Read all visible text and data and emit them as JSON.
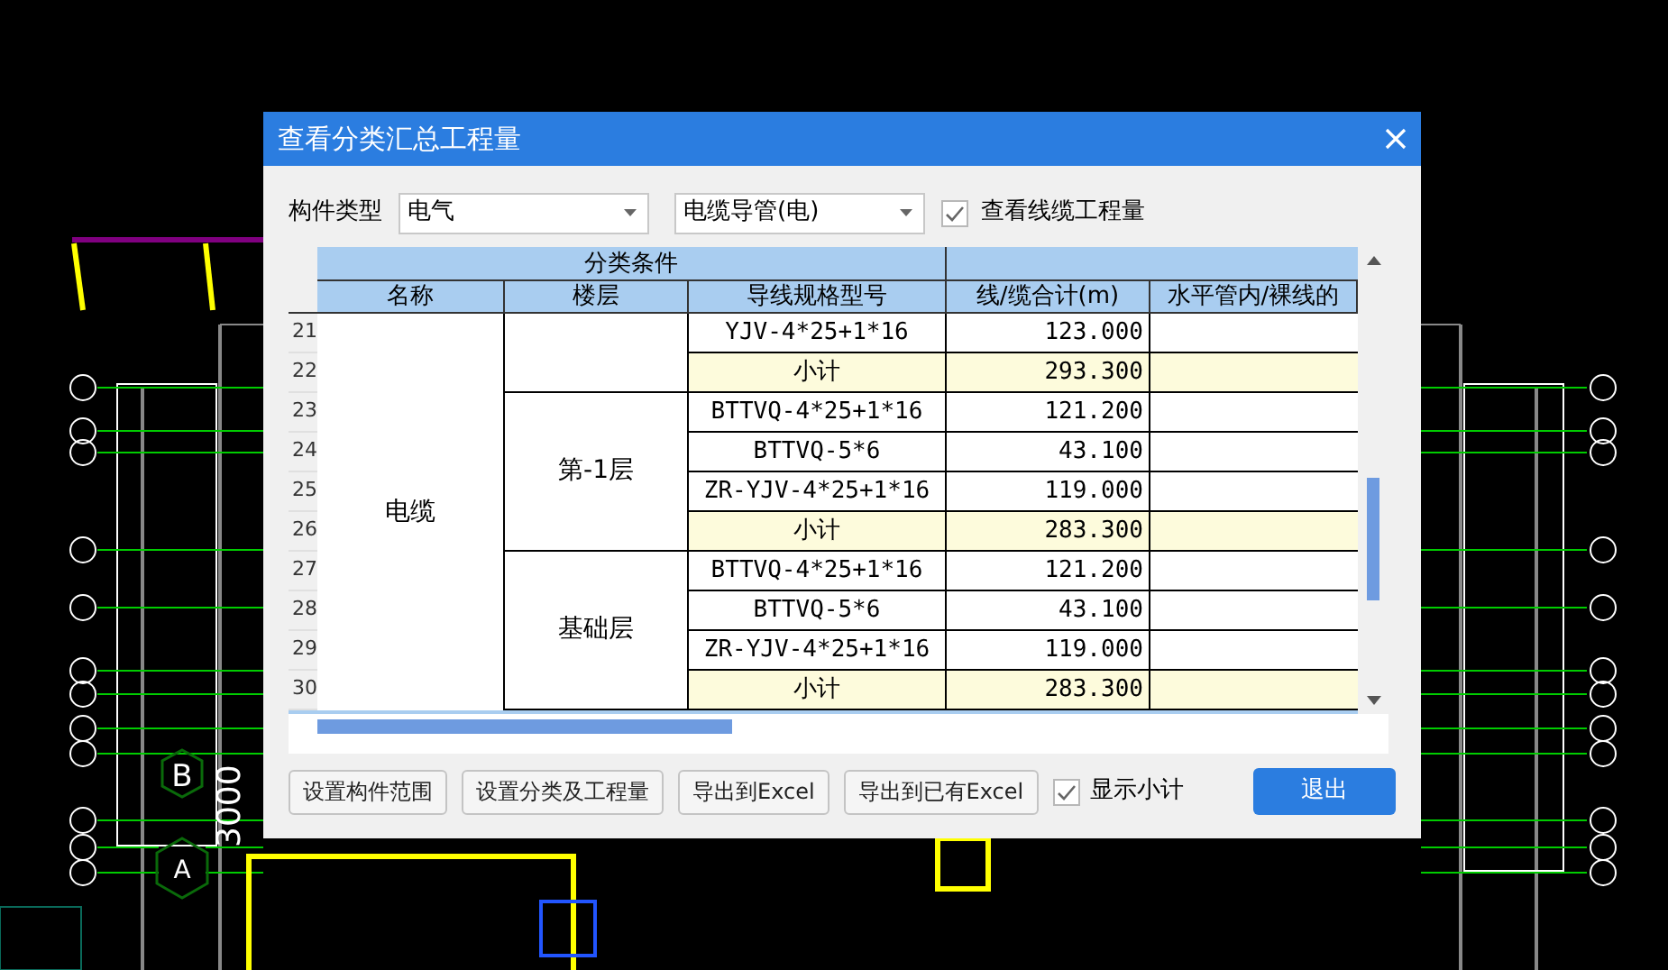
{
  "cad_labels": [
    {
      "text": "B"
    },
    {
      "text": "A"
    },
    {
      "text": "3000",
      "kind": "vertical"
    }
  ],
  "window": {
    "title": "查看分类汇总工程量"
  },
  "toolbar": {
    "label": "构件类型",
    "type_select": {
      "value": "电气"
    },
    "sub_select": {
      "value": "电缆导管(电)"
    },
    "show_cable": {
      "label": "查看线缆工程量",
      "checked": true
    }
  },
  "table": {
    "group_header": "分类条件",
    "columns": [
      "名称",
      "楼层",
      "导线规格型号",
      "线/缆合计(m)",
      "水平管内/裸线的"
    ],
    "name_cell": "电缆",
    "floors": [
      {
        "rows": [
          {
            "num": "21",
            "kind": "item",
            "spec": "YJV-4*25+1*16",
            "total": "123.000"
          },
          {
            "num": "22",
            "kind": "subtotal",
            "spec": "小计",
            "total": "293.300"
          }
        ]
      },
      {
        "label": "第-1层",
        "rows": [
          {
            "num": "23",
            "kind": "item",
            "spec": "BTTVQ-4*25+1*16",
            "total": "121.200"
          },
          {
            "num": "24",
            "kind": "item",
            "spec": "BTTVQ-5*6",
            "total": "43.100"
          },
          {
            "num": "25",
            "kind": "item",
            "spec": "ZR-YJV-4*25+1*16",
            "total": "119.000"
          },
          {
            "num": "26",
            "kind": "subtotal",
            "spec": "小计",
            "total": "283.300"
          }
        ]
      },
      {
        "label": "基础层",
        "rows": [
          {
            "num": "27",
            "kind": "item",
            "spec": "BTTVQ-4*25+1*16",
            "total": "121.200"
          },
          {
            "num": "28",
            "kind": "item",
            "spec": "BTTVQ-5*6",
            "total": "43.100"
          },
          {
            "num": "29",
            "kind": "item",
            "spec": "ZR-YJV-4*25+1*16",
            "total": "119.000"
          },
          {
            "num": "30",
            "kind": "subtotal",
            "spec": "小计",
            "total": "283.300"
          }
        ]
      }
    ]
  },
  "buttons": [
    {
      "label": "设置构件范围",
      "kind": "normal"
    },
    {
      "label": "设置分类及工程量",
      "kind": "normal"
    },
    {
      "label": "导出到Excel",
      "kind": "normal"
    },
    {
      "label": "导出到已有Excel",
      "kind": "normal"
    }
  ],
  "show_subtotal": {
    "label": "显示小计",
    "checked": true
  },
  "exit_button": {
    "label": "退出"
  }
}
